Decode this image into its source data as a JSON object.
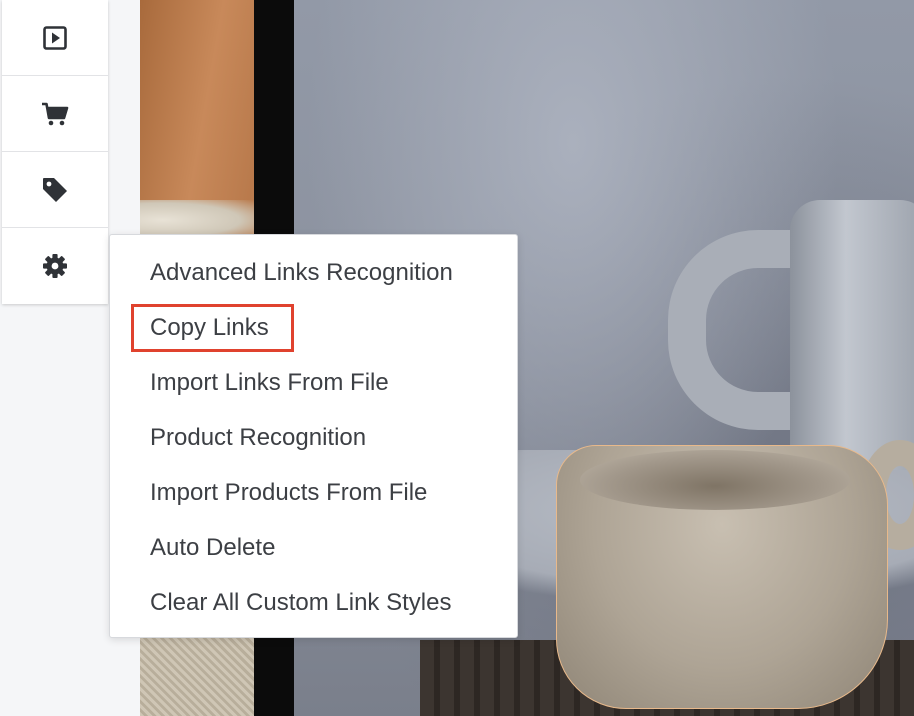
{
  "sidebar": {
    "items": [
      {
        "icon": "play-icon"
      },
      {
        "icon": "cart-icon"
      },
      {
        "icon": "tag-icon"
      },
      {
        "icon": "gear-icon"
      }
    ]
  },
  "menu": {
    "items": [
      {
        "label": "Advanced Links Recognition"
      },
      {
        "label": "Copy Links"
      },
      {
        "label": "Import Links From File"
      },
      {
        "label": "Product Recognition"
      },
      {
        "label": "Import Products From File"
      },
      {
        "label": "Auto Delete"
      },
      {
        "label": "Clear All Custom Link Styles"
      }
    ],
    "highlighted_item": "Copy Links"
  },
  "colors": {
    "highlight_border": "#e0422e",
    "icon": "#2f3237",
    "menu_text": "#3c3f44"
  }
}
